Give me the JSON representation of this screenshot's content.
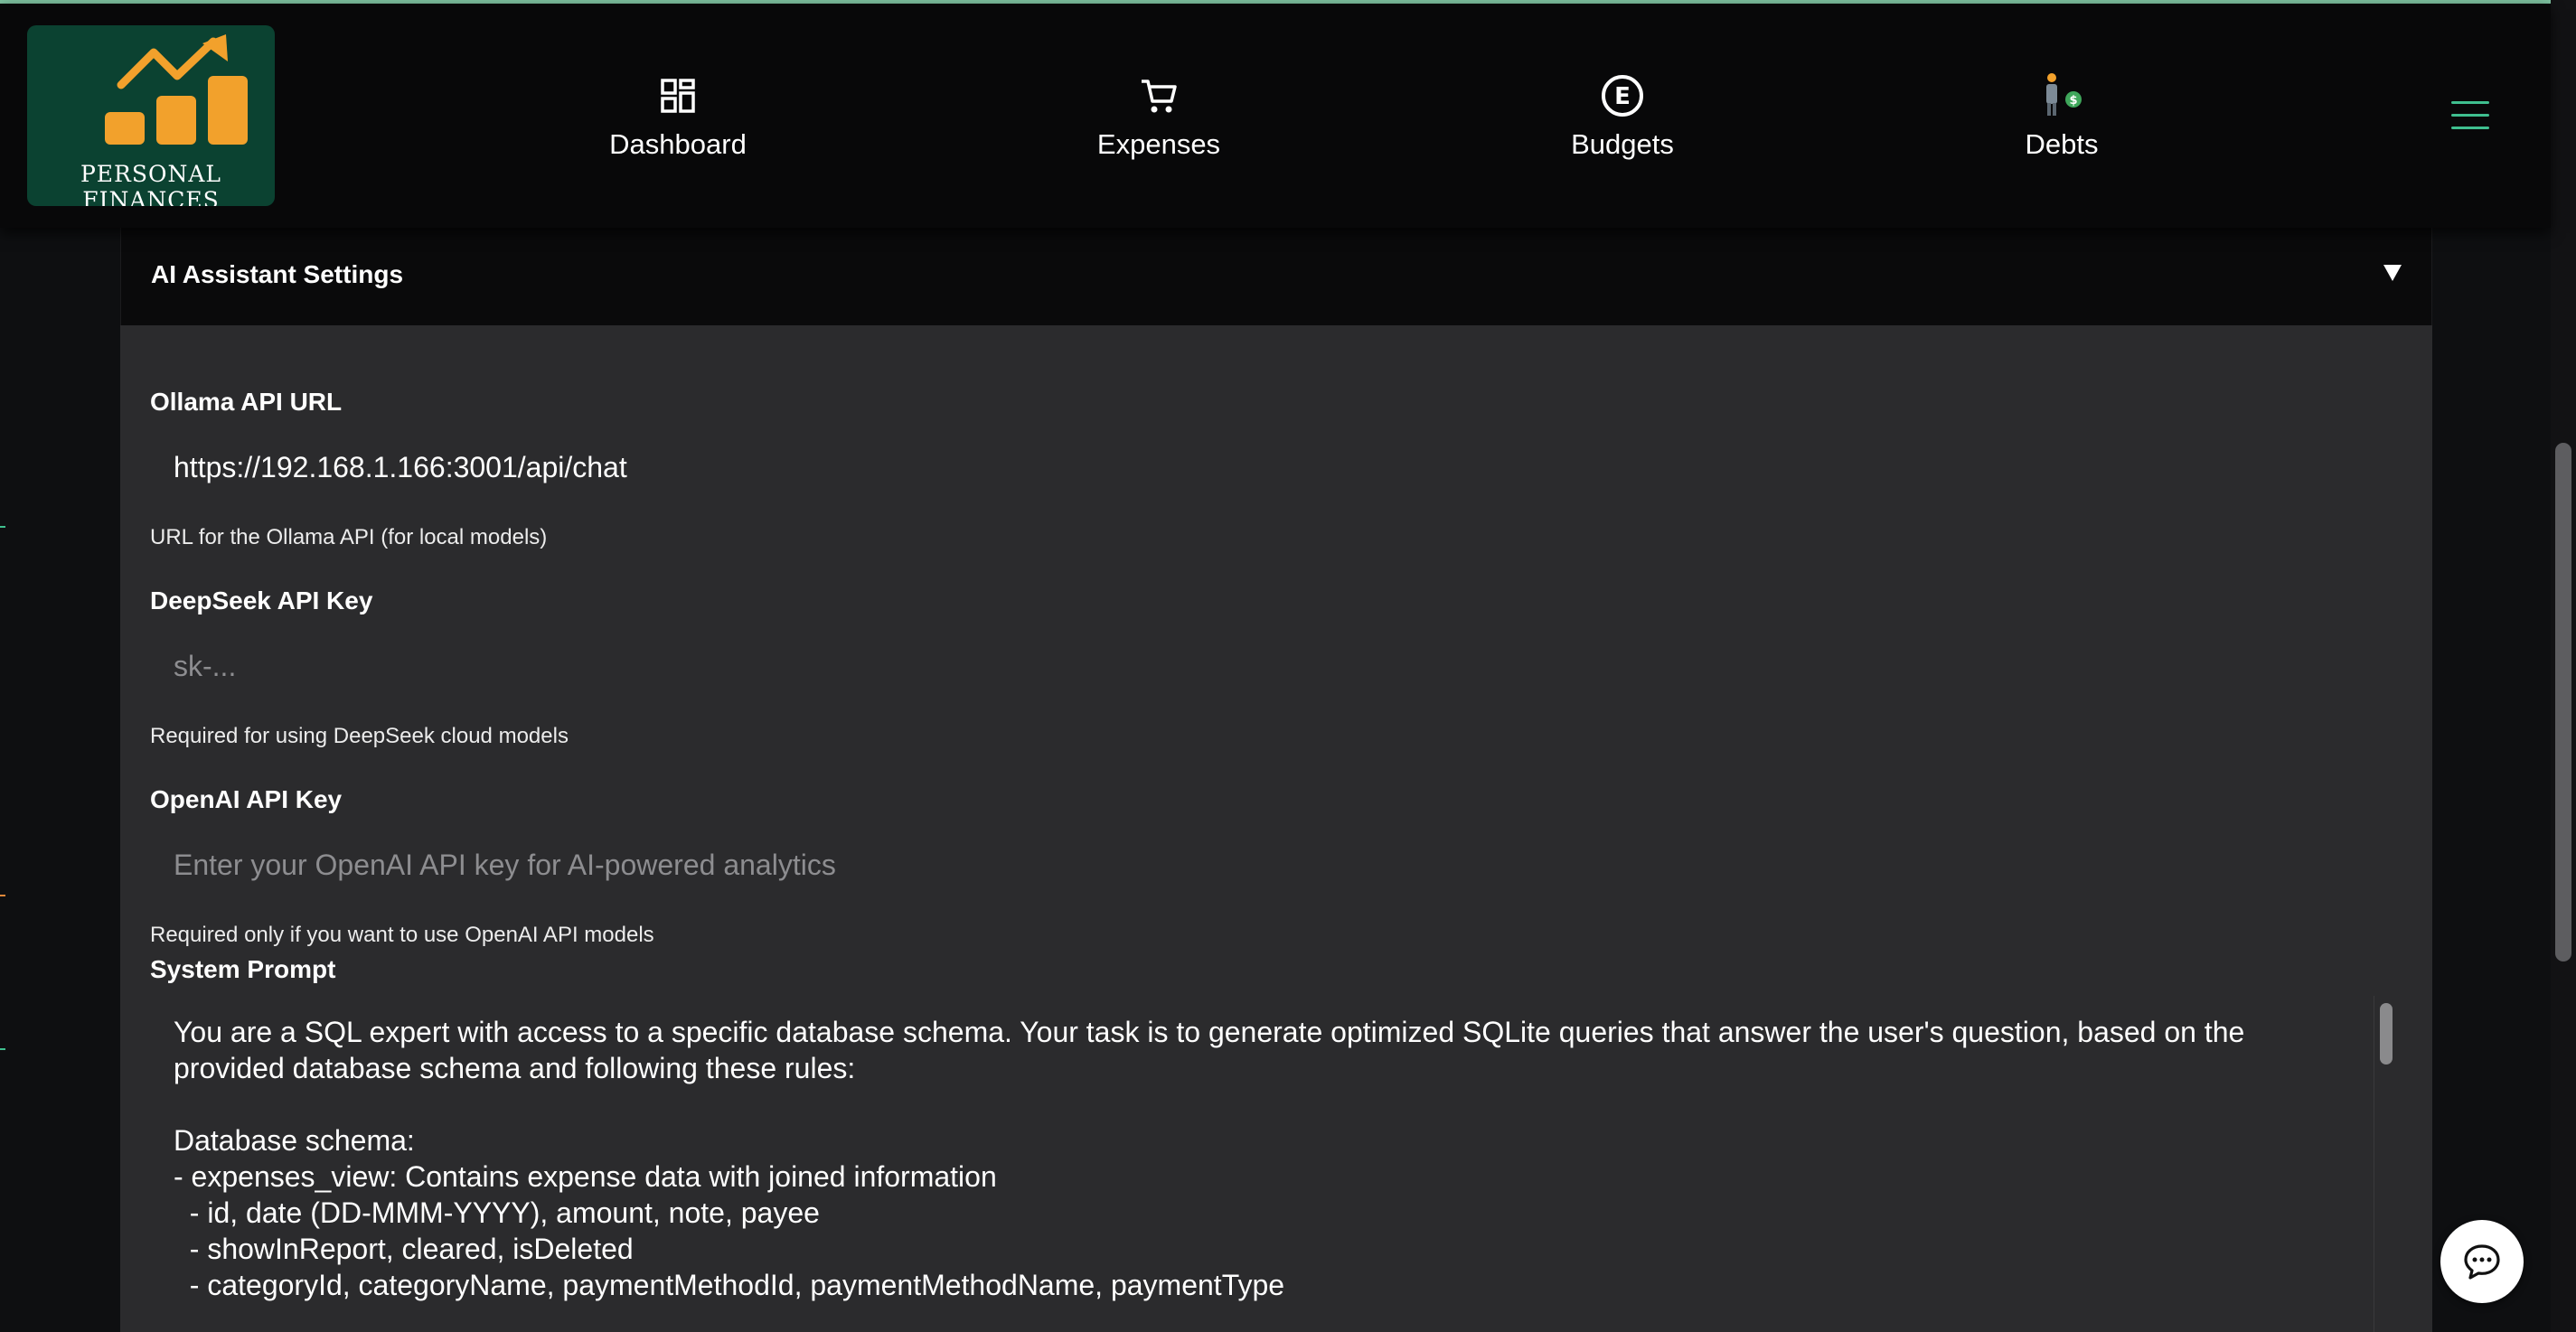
{
  "app": {
    "logo_text": "PERSONAL FINANCES",
    "brand_color": "#0b4231",
    "accent_color": "#f2a12c"
  },
  "nav": {
    "items": [
      {
        "label": "Dashboard",
        "icon": "dashboard-icon"
      },
      {
        "label": "Expenses",
        "icon": "cart-icon"
      },
      {
        "label": "Budgets",
        "icon": "euro-circle-icon"
      },
      {
        "label": "Debts",
        "icon": "person-dollar-icon"
      }
    ],
    "menu_icon": "hamburger-menu-icon"
  },
  "panel": {
    "title": "AI Assistant Settings",
    "toggle_icon": "triangle-down-icon"
  },
  "fields": {
    "ollama": {
      "label": "Ollama API URL",
      "value": "https://192.168.1.166:3001/api/chat",
      "help": "URL for the Ollama API (for local models)"
    },
    "deepseek": {
      "label": "DeepSeek API Key",
      "placeholder": "sk-...",
      "help": "Required for using DeepSeek cloud models"
    },
    "openai": {
      "label": "OpenAI API Key",
      "placeholder": "Enter your OpenAI API key for AI-powered analytics",
      "help": "Required only if you want to use OpenAI API models"
    },
    "system_prompt": {
      "label": "System Prompt",
      "value": "You are a SQL expert with access to a specific database schema. Your task is to generate optimized SQLite queries that answer the user's question, based on the provided database schema and following these rules:\n\nDatabase schema:\n- expenses_view: Contains expense data with joined information\n  - id, date (DD-MMM-YYYY), amount, note, payee\n  - showInReport, cleared, isDeleted\n  - categoryId, categoryName, paymentMethodId, paymentMethodName, paymentType"
    }
  },
  "chat": {
    "icon": "chat-bubble-icon"
  }
}
